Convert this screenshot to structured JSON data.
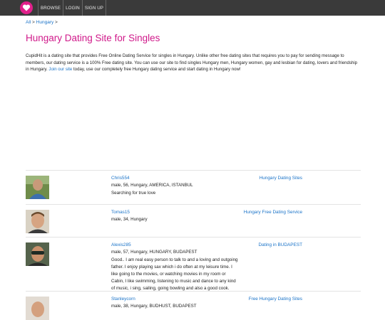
{
  "nav": {
    "browse": "BROWSE",
    "login": "LOGIN",
    "signup": "SIGN UP"
  },
  "breadcrumb": {
    "all": "All",
    "sep1": ">",
    "hungary": "Hungary",
    "sep2": ">"
  },
  "page_title": "Hungary Dating Site for Singles",
  "intro": {
    "text1": "CupidHit is a dating site that provides Free Online Dating Service for singles in Hungary. Unlike other free dating sites that requires you to pay for sending message to members, our dating service is a 100% Free dating site. You can use our site to find singles Hungary men, Hungary women, gay and lesbian for dating, lovers and friendship in Hungary.",
    "link": "Join our site",
    "text2": "today, use our completely free Hungary dating service and start dating in Hungary now!"
  },
  "listings": [
    {
      "name": "Chris554",
      "tag": "Hungary Dating Sites",
      "meta": "male, 56, Hungary, AMERICA, ISTANBUL",
      "desc": "Searching for true love"
    },
    {
      "name": "Tomas15",
      "tag": "Hungary Free Dating Service",
      "meta": "male, 34, Hungary",
      "desc": ""
    },
    {
      "name": "Alexis285",
      "tag": "Dating in BUDAPEST",
      "meta": "male, 57, Hungary, HUNGARY, BUDAPEST",
      "desc": "Good.. I am real easy person to talk to and a loving and outgoing father. I enjoy playing sax which i do often at my leisure time. I like going to the movies, or watching movies in my room or Cabin, I like swimming, listening to music and dance to any kind of music, i sing, sailing, going bowling and also a good cook."
    },
    {
      "name": "Stanleycorn",
      "tag": "Free Hungary Dating Sites",
      "meta": "male, 38, Hungary, BUDHUST, BUDAPEST",
      "desc": ""
    }
  ],
  "colors": {
    "accent": "#d0198a",
    "link": "#1a73c8",
    "topbar": "#3a3a3a"
  }
}
